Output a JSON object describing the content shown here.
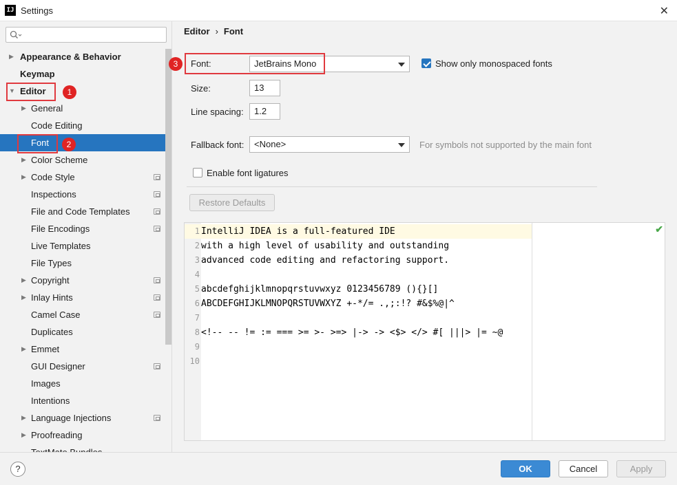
{
  "window": {
    "title": "Settings",
    "app_icon": "IJ"
  },
  "sidebar": {
    "search_placeholder": "",
    "items": [
      {
        "label": "Appearance & Behavior",
        "level": 0,
        "arrow": "▶"
      },
      {
        "label": "Keymap",
        "level": 0,
        "arrow": ""
      },
      {
        "label": "Editor",
        "level": 0,
        "arrow": "▼"
      },
      {
        "label": "General",
        "level": 1,
        "arrow": "▶"
      },
      {
        "label": "Code Editing",
        "level": 1,
        "arrow": ""
      },
      {
        "label": "Font",
        "level": 1,
        "arrow": "",
        "selected": true
      },
      {
        "label": "Color Scheme",
        "level": 1,
        "arrow": "▶"
      },
      {
        "label": "Code Style",
        "level": 1,
        "arrow": "▶",
        "project": true
      },
      {
        "label": "Inspections",
        "level": 1,
        "arrow": "",
        "project": true
      },
      {
        "label": "File and Code Templates",
        "level": 1,
        "arrow": "",
        "project": true
      },
      {
        "label": "File Encodings",
        "level": 1,
        "arrow": "",
        "project": true
      },
      {
        "label": "Live Templates",
        "level": 1,
        "arrow": ""
      },
      {
        "label": "File Types",
        "level": 1,
        "arrow": ""
      },
      {
        "label": "Copyright",
        "level": 1,
        "arrow": "▶",
        "project": true
      },
      {
        "label": "Inlay Hints",
        "level": 1,
        "arrow": "▶",
        "project": true
      },
      {
        "label": "Camel Case",
        "level": 1,
        "arrow": "",
        "project": true
      },
      {
        "label": "Duplicates",
        "level": 1,
        "arrow": ""
      },
      {
        "label": "Emmet",
        "level": 1,
        "arrow": "▶"
      },
      {
        "label": "GUI Designer",
        "level": 1,
        "arrow": "",
        "project": true
      },
      {
        "label": "Images",
        "level": 1,
        "arrow": ""
      },
      {
        "label": "Intentions",
        "level": 1,
        "arrow": ""
      },
      {
        "label": "Language Injections",
        "level": 1,
        "arrow": "▶",
        "project": true
      },
      {
        "label": "Proofreading",
        "level": 1,
        "arrow": "▶"
      },
      {
        "label": "TextMate Bundles",
        "level": 1,
        "arrow": ""
      }
    ]
  },
  "annotations": {
    "badge1": "1",
    "badge2": "2",
    "badge3": "3"
  },
  "breadcrumb": {
    "parent": "Editor",
    "separator": "›",
    "current": "Font"
  },
  "font_settings": {
    "font_label": "Font:",
    "font_value": "JetBrains Mono",
    "mono_label": "Show only monospaced fonts",
    "mono_checked": true,
    "size_label": "Size:",
    "size_value": "13",
    "spacing_label": "Line spacing:",
    "spacing_value": "1.2",
    "fallback_label": "Fallback font:",
    "fallback_value": "<None>",
    "fallback_hint": "For symbols not supported by the main font",
    "ligatures_label": "Enable font ligatures",
    "ligatures_checked": false,
    "restore_label": "Restore Defaults"
  },
  "preview": {
    "lines": [
      {
        "n": "1",
        "text": "IntelliJ IDEA is a full-featured IDE"
      },
      {
        "n": "2",
        "text": "with a high level of usability and outstanding"
      },
      {
        "n": "3",
        "text": "advanced code editing and refactoring support."
      },
      {
        "n": "4",
        "text": ""
      },
      {
        "n": "5",
        "text": "abcdefghijklmnopqrstuvwxyz 0123456789 (){}[]"
      },
      {
        "n": "6",
        "text": "ABCDEFGHIJKLMNOPQRSTUVWXYZ +-*/= .,;:!? #&$%@|^"
      },
      {
        "n": "7",
        "text": ""
      },
      {
        "n": "8",
        "text": "<!-- -- != := === >= >- >=> |-> -> <$> </> #[ |||> |= ~@"
      },
      {
        "n": "9",
        "text": ""
      },
      {
        "n": "10",
        "text": ""
      }
    ],
    "status_icon": "check-icon"
  },
  "footer": {
    "help": "?",
    "ok": "OK",
    "cancel": "Cancel",
    "apply": "Apply"
  },
  "colors": {
    "accent": "#2675bf",
    "annotation": "#e0393e",
    "primary_button": "#3b8ad4"
  }
}
